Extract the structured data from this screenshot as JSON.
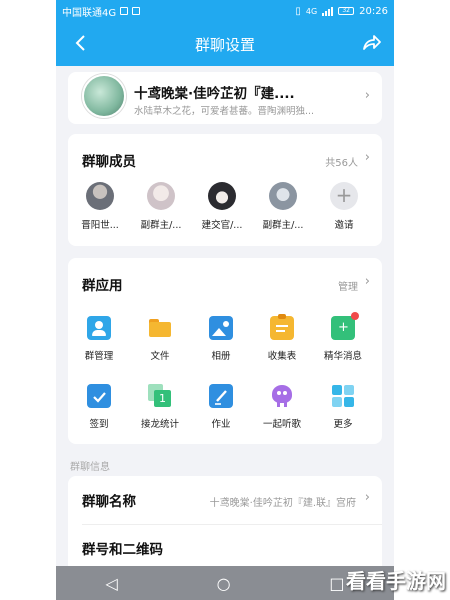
{
  "status_bar": {
    "carrier": "中国联通4G",
    "network": "4G",
    "battery": "32",
    "time": "20:26"
  },
  "header": {
    "title": "群聊设置",
    "back_icon": "back-arrow-icon",
    "share_icon": "share-icon"
  },
  "group": {
    "name": "十鸢晚棠·佳吟芷初『建....",
    "description": "水陆草木之花，可爱者甚蕃。晋陶渊明独..."
  },
  "members": {
    "title": "群聊成员",
    "count": "共56人",
    "items": [
      {
        "label": "晋阳世...",
        "color": "#6b6f78"
      },
      {
        "label": "副群主/...",
        "color": "#d8d0d4"
      },
      {
        "label": "建交官/...",
        "color": "#2b2b30"
      },
      {
        "label": "副群主/...",
        "color": "#9aa3ad"
      },
      {
        "label": "邀请",
        "icon": "plus-icon"
      }
    ]
  },
  "apps": {
    "title": "群应用",
    "manage": "管理",
    "items": [
      {
        "label": "群管理",
        "icon": "group-manage-icon",
        "color": "#2fa6e8"
      },
      {
        "label": "文件",
        "icon": "folder-icon",
        "color": "#f5a623"
      },
      {
        "label": "相册",
        "icon": "album-icon",
        "color": "#2f8fe0"
      },
      {
        "label": "收集表",
        "icon": "clipboard-icon",
        "color": "#f5a623"
      },
      {
        "label": "精华消息",
        "icon": "highlight-message-icon",
        "color": "#33c07a"
      },
      {
        "label": "签到",
        "icon": "calendar-check-icon",
        "color": "#2f8fe0"
      },
      {
        "label": "接龙统计",
        "icon": "relay-count-icon",
        "color": "#33c07a"
      },
      {
        "label": "作业",
        "icon": "homework-icon",
        "color": "#2f8fe0"
      },
      {
        "label": "一起听歌",
        "icon": "listen-music-icon",
        "color": "#a66ee6"
      },
      {
        "label": "更多",
        "icon": "more-grid-icon",
        "color": "#35b6e8"
      }
    ]
  },
  "info": {
    "section_label": "群聊信息",
    "name_title": "群聊名称",
    "name_value": "十鸢晚棠·佳吟芷初『建.联』宫府",
    "qr_title": "群号和二维码"
  },
  "nav": {
    "back": "◁",
    "home": "○",
    "recent": "□"
  },
  "watermark": "看看手游网"
}
